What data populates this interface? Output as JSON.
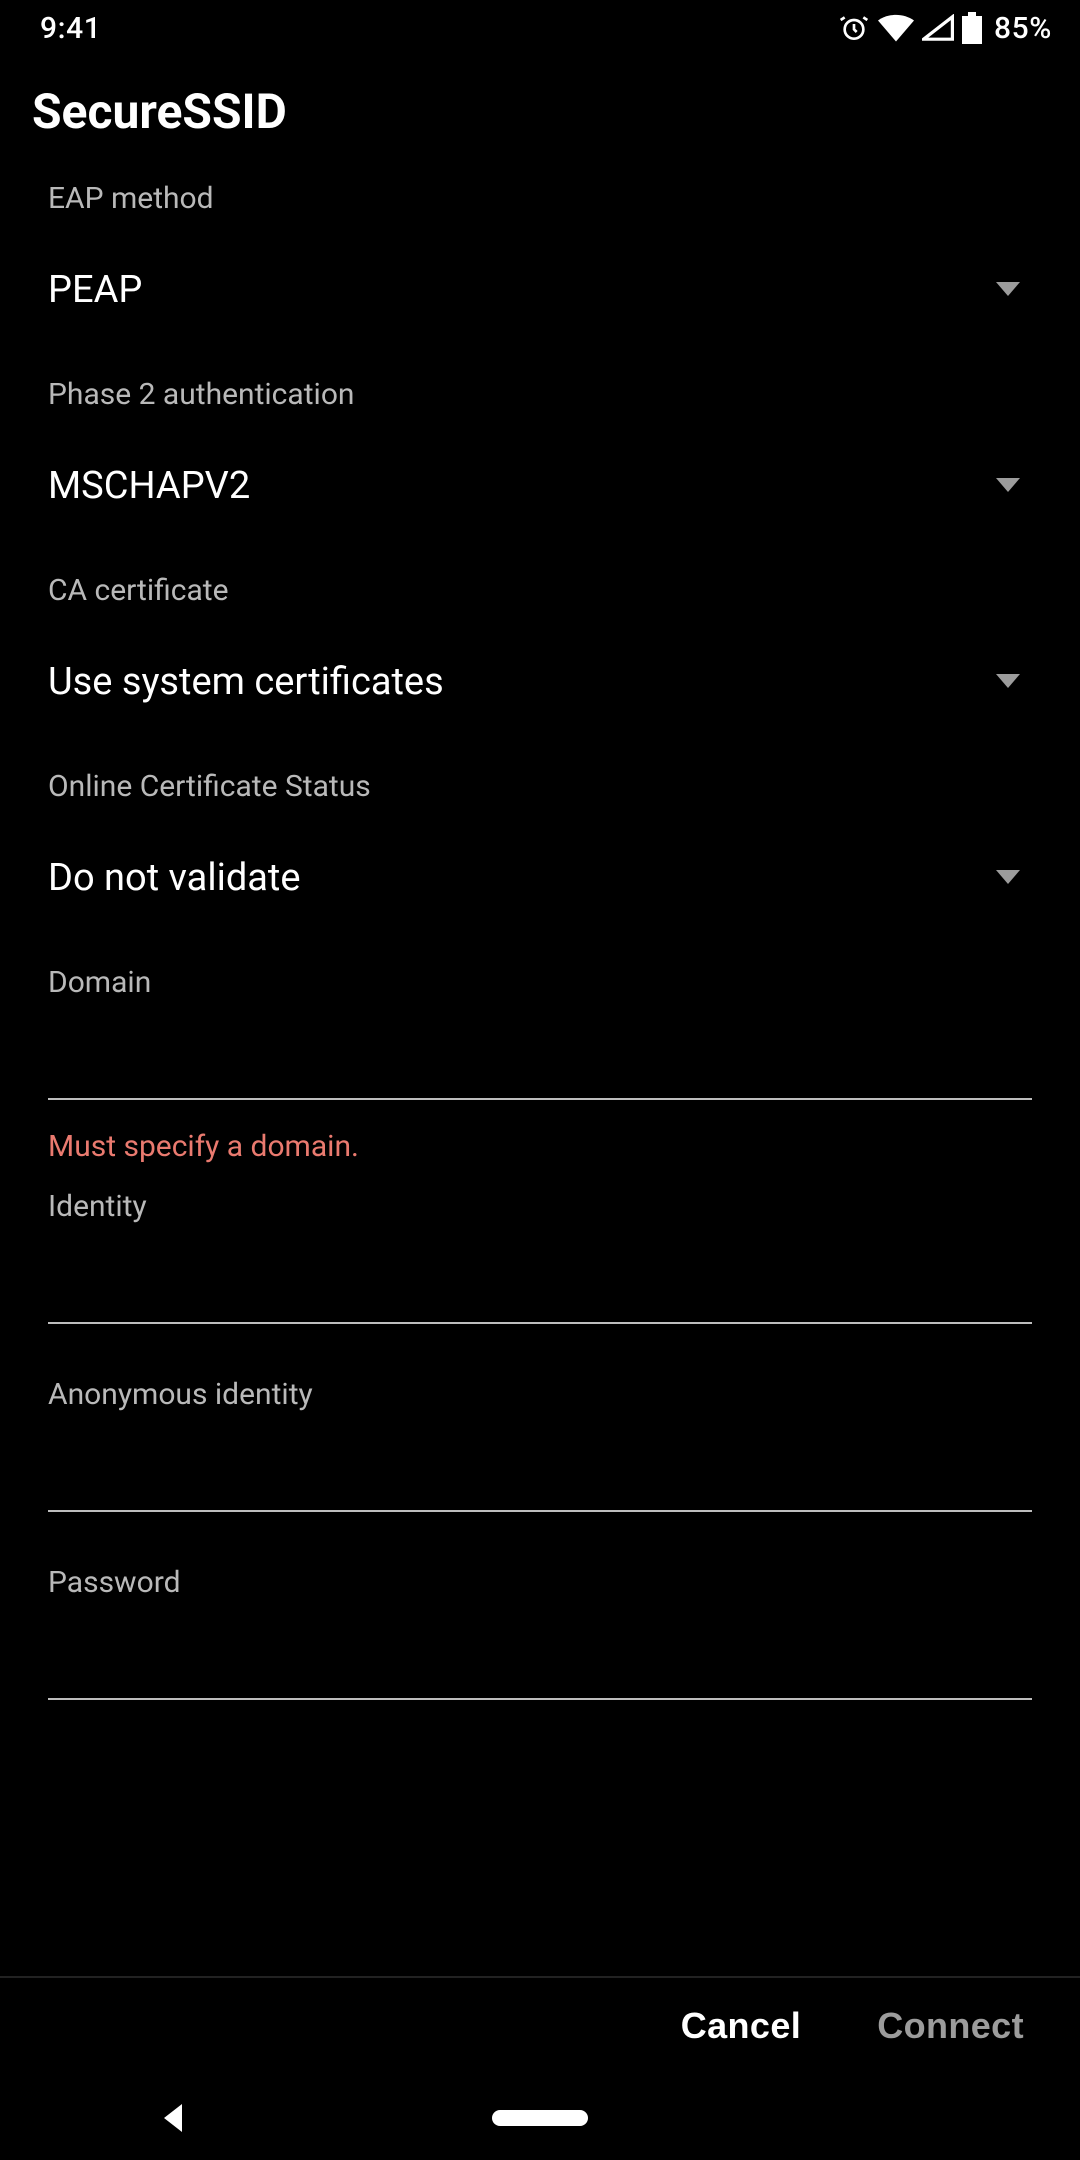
{
  "statusbar": {
    "time": "9:41",
    "battery_text": "85%"
  },
  "title": "SecureSSID",
  "fields": {
    "eap": {
      "label": "EAP method",
      "value": "PEAP"
    },
    "phase2": {
      "label": "Phase 2 authentication",
      "value": "MSCHAPV2"
    },
    "ca_cert": {
      "label": "CA certificate",
      "value": "Use system certificates"
    },
    "ocsp": {
      "label": "Online Certificate Status",
      "value": "Do not validate"
    },
    "domain": {
      "label": "Domain",
      "value": "",
      "error": "Must specify a domain."
    },
    "identity": {
      "label": "Identity",
      "value": ""
    },
    "anon_id": {
      "label": "Anonymous identity",
      "value": ""
    },
    "password": {
      "label": "Password",
      "value": ""
    }
  },
  "buttons": {
    "cancel": "Cancel",
    "connect": "Connect"
  }
}
